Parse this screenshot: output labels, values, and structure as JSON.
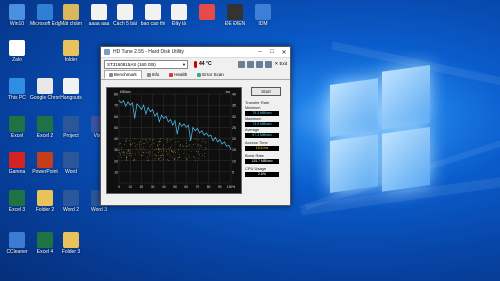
{
  "desktop_icons": [
    {
      "label": "Win10",
      "color": "#4a8fe0"
    },
    {
      "label": "Microsoft Edge",
      "color": "#2f7fd6"
    },
    {
      "label": "Mất chấm",
      "color": "#d9b85c"
    },
    {
      "label": "aaaa aaa",
      "color": "#f2f2f2"
    },
    {
      "label": "Cách 5 bài",
      "color": "#f2f2f2"
    },
    {
      "label": "bao cao thi",
      "color": "#f2f2f2"
    },
    {
      "label": "Đây là",
      "color": "#f2f2f2"
    },
    {
      "label": "",
      "color": "#e54b4b"
    },
    {
      "label": "ĐỀ ĐIỆN",
      "color": "#333"
    },
    {
      "label": "IDM",
      "color": "#3e7fd6"
    },
    {
      "label": "Zalo",
      "color": "#ffffff"
    },
    {
      "label": "folder",
      "color": "#e9c25b"
    },
    {
      "label": "This PC",
      "color": "#2f8de4"
    },
    {
      "label": "Google Chrome",
      "color": "#e8e8e8"
    },
    {
      "label": "Hangouts",
      "color": "#f2f2f2"
    },
    {
      "label": "Excel",
      "color": "#1f7244"
    },
    {
      "label": "Excel 2",
      "color": "#1f7244"
    },
    {
      "label": "Project",
      "color": "#2b579a"
    },
    {
      "label": "Visio",
      "color": "#3955a3"
    },
    {
      "label": "Garena",
      "color": "#d32222"
    },
    {
      "label": "PowerPoint",
      "color": "#c43e1c"
    },
    {
      "label": "Word",
      "color": "#2b579a"
    },
    {
      "label": "Excel 3",
      "color": "#1f7244"
    },
    {
      "label": "Folder 2",
      "color": "#e9c25b"
    },
    {
      "label": "Word 2",
      "color": "#2b579a"
    },
    {
      "label": "Word 3",
      "color": "#2b579a"
    },
    {
      "label": "CCleaner",
      "color": "#3b7bd3"
    },
    {
      "label": "Excel 4",
      "color": "#1f7244"
    },
    {
      "label": "Folder 3",
      "color": "#e9c25b"
    }
  ],
  "window": {
    "title": "HD Tune 2.55 - Hard Disk Utility",
    "drive": "ST3160815AS (160 GB)",
    "temperature": "44 °C",
    "exit_label": "Exit",
    "tabs": [
      {
        "label": "Benchmark"
      },
      {
        "label": "Info"
      },
      {
        "label": "Health"
      },
      {
        "label": "Error Scan"
      }
    ],
    "start_label": "Start",
    "stats": {
      "transfer_rate": "Transfer Rate",
      "minimum_label": "Minimum",
      "minimum": "75.3 MB/sec",
      "maximum_label": "Maximum",
      "maximum": "73.5 MB/sec",
      "average_label": "Average",
      "average": "57.3 MB/sec",
      "access_time_label": "Access Time",
      "access_time": "16.6 ms",
      "burst_rate_label": "Burst Rate",
      "burst_rate": "125.7 MB/sec",
      "cpu_usage_label": "CPU Usage",
      "cpu_usage": "2.6%"
    }
  },
  "chart_data": {
    "type": "line",
    "y_label_left": "MB/sec",
    "y_label_right": "ms",
    "y_ticks_left": [
      "80",
      "70",
      "60",
      "50",
      "40",
      "30",
      "20",
      "10"
    ],
    "y_ticks_right": [
      "40",
      "35",
      "30",
      "25",
      "20",
      "15",
      "10",
      "5"
    ],
    "x_ticks": [
      "0",
      "10",
      "20",
      "30",
      "40",
      "50",
      "60",
      "70",
      "80",
      "90",
      "100%"
    ],
    "ylim_left": [
      0,
      80
    ],
    "xlim": [
      0,
      100
    ],
    "series": [
      {
        "name": "transfer",
        "values": [
          {
            "x": 0,
            "y": 74
          },
          {
            "x": 2,
            "y": 72
          },
          {
            "x": 4,
            "y": 74
          },
          {
            "x": 6,
            "y": 69
          },
          {
            "x": 8,
            "y": 73
          },
          {
            "x": 10,
            "y": 70
          },
          {
            "x": 12,
            "y": 72
          },
          {
            "x": 14,
            "y": 58
          },
          {
            "x": 16,
            "y": 71
          },
          {
            "x": 18,
            "y": 69
          },
          {
            "x": 20,
            "y": 66
          },
          {
            "x": 22,
            "y": 70
          },
          {
            "x": 24,
            "y": 62
          },
          {
            "x": 26,
            "y": 68
          },
          {
            "x": 28,
            "y": 64
          },
          {
            "x": 30,
            "y": 66
          },
          {
            "x": 32,
            "y": 60
          },
          {
            "x": 34,
            "y": 63
          },
          {
            "x": 36,
            "y": 55
          },
          {
            "x": 38,
            "y": 61
          },
          {
            "x": 40,
            "y": 58
          },
          {
            "x": 42,
            "y": 60
          },
          {
            "x": 44,
            "y": 55
          },
          {
            "x": 46,
            "y": 57
          },
          {
            "x": 48,
            "y": 52
          },
          {
            "x": 50,
            "y": 56
          },
          {
            "x": 52,
            "y": 44
          },
          {
            "x": 54,
            "y": 54
          },
          {
            "x": 56,
            "y": 51
          },
          {
            "x": 58,
            "y": 53
          },
          {
            "x": 60,
            "y": 50
          },
          {
            "x": 62,
            "y": 52
          },
          {
            "x": 64,
            "y": 38
          },
          {
            "x": 66,
            "y": 50
          },
          {
            "x": 68,
            "y": 47
          },
          {
            "x": 70,
            "y": 49
          },
          {
            "x": 72,
            "y": 45
          },
          {
            "x": 74,
            "y": 47
          },
          {
            "x": 76,
            "y": 43
          },
          {
            "x": 78,
            "y": 45
          },
          {
            "x": 80,
            "y": 42
          },
          {
            "x": 82,
            "y": 43
          },
          {
            "x": 84,
            "y": 38
          },
          {
            "x": 86,
            "y": 41
          },
          {
            "x": 88,
            "y": 37
          },
          {
            "x": 90,
            "y": 39
          },
          {
            "x": 92,
            "y": 35
          },
          {
            "x": 94,
            "y": 37
          },
          {
            "x": 96,
            "y": 33
          },
          {
            "x": 98,
            "y": 34
          },
          {
            "x": 100,
            "y": 30
          }
        ]
      }
    ],
    "access_time_band_ms": [
      10,
      20
    ],
    "grid": true
  }
}
